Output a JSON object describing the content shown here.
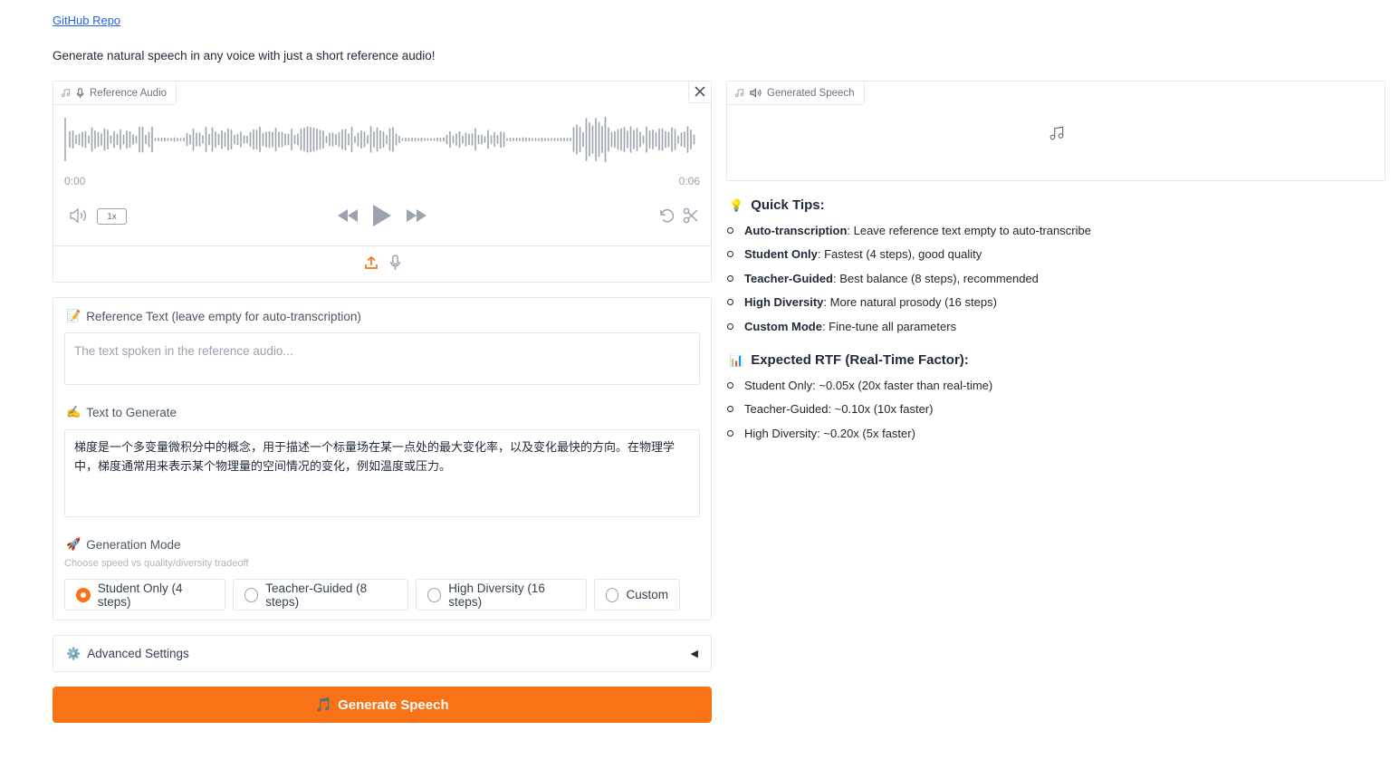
{
  "header": {
    "repo_link": "GitHub Repo",
    "description": "Generate natural speech in any voice with just a short reference audio!"
  },
  "reference_audio": {
    "label": "Reference Audio",
    "label_icon": "microphone-icon",
    "time_start": "0:00",
    "time_end": "0:06",
    "playback_speed": "1x"
  },
  "reference_text": {
    "emoji": "📝",
    "label": "Reference Text (leave empty for auto-transcription)",
    "placeholder": "The text spoken in the reference audio..."
  },
  "text_to_generate": {
    "emoji": "✍️",
    "label": "Text to Generate",
    "value": "梯度是一个多变量微积分中的概念，用于描述一个标量场在某一点处的最大变化率，以及变化最快的方向。在物理学中，梯度通常用来表示某个物理量的空间情况的变化，例如温度或压力。"
  },
  "generation_mode": {
    "emoji": "🚀",
    "label": "Generation Mode",
    "info": "Choose speed vs quality/diversity tradeoff",
    "options": [
      "Student Only (4 steps)",
      "Teacher-Guided (8 steps)",
      "High Diversity (16 steps)",
      "Custom"
    ],
    "selected": "Student Only (4 steps)"
  },
  "advanced_settings": {
    "emoji": "⚙️",
    "label": "Advanced Settings",
    "arrow": "◀"
  },
  "generate_button": {
    "emoji": "🎵",
    "label": "Generate Speech"
  },
  "generated_speech": {
    "label": "Generated Speech",
    "label_icon": "speaker-icon"
  },
  "quick_tips": {
    "emoji": "💡",
    "title": "Quick Tips:",
    "items": [
      {
        "term": "Auto-transcription",
        "text": ": Leave reference text empty to auto-transcribe"
      },
      {
        "term": "Student Only",
        "text": ": Fastest (4 steps), good quality"
      },
      {
        "term": "Teacher-Guided",
        "text": ": Best balance (8 steps), recommended"
      },
      {
        "term": "High Diversity",
        "text": ": More natural prosody (16 steps)"
      },
      {
        "term": "Custom Mode",
        "text": ": Fine-tune all parameters"
      }
    ]
  },
  "expected_rtf": {
    "emoji": "📊",
    "title": "Expected RTF (Real-Time Factor):",
    "items": [
      "Student Only: ~0.05x (20x faster than real-time)",
      "Teacher-Guided: ~0.10x (10x faster)",
      "High Diversity: ~0.20x (5x faster)"
    ]
  }
}
